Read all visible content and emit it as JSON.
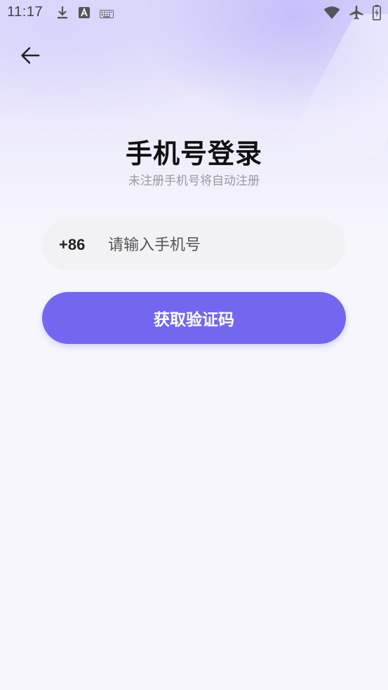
{
  "status_bar": {
    "time": "11:17",
    "left_icons": [
      "download-icon",
      "font-a-icon",
      "keyboard-icon"
    ],
    "right_icons": [
      "wifi-icon",
      "airplane-mode-icon",
      "battery-charging-icon"
    ]
  },
  "header": {
    "back_icon": "arrow-left-icon"
  },
  "login": {
    "title": "手机号登录",
    "subtitle": "未注册手机号将自动注册",
    "country_code": "+86",
    "phone_placeholder": "请输入手机号",
    "phone_value": "",
    "submit_label": "获取验证码"
  },
  "colors": {
    "accent": "#7367f0",
    "field_bg": "#f2f2f4",
    "page_bg": "#f6f6fc",
    "title": "#111111",
    "subtitle": "#9a9a9a"
  }
}
